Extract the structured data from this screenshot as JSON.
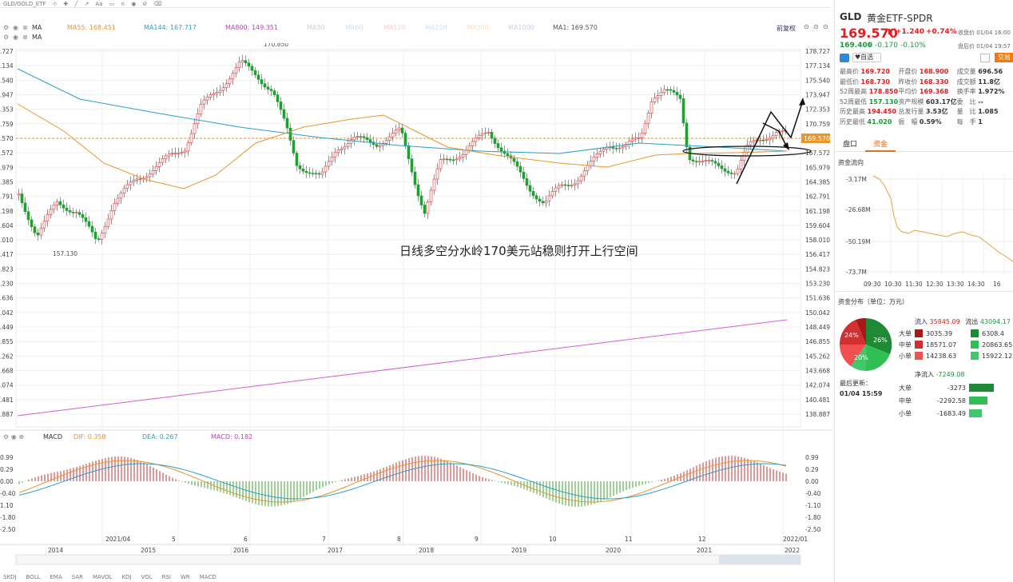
{
  "toolbar": {
    "ticker": "GLD/GOLD_ETF",
    "icons": [
      "cursor-icon",
      "crosshair-icon",
      "line-icon",
      "ray-icon",
      "text-icon",
      "ruler-icon",
      "magnet-icon",
      "eye-icon",
      "lock-icon",
      "trash-icon"
    ]
  },
  "ma_bar1": {
    "label": "MA",
    "ma55": "MA55: 168.451",
    "ma144": "MA144: 167.717",
    "ma800": "MA800: 149.351",
    "ma30": "MA30",
    "ma60": "MA60",
    "ma120": "MA120",
    "ma250": "MA250",
    "ma500": "MA500",
    "ma1000": "MA1000",
    "ma1": "MA1: 169.570",
    "fuquan": "前复权"
  },
  "ma_bar2": {
    "label": "MA"
  },
  "peak_label": "170.850",
  "low_label": "157.130",
  "annotation": "日线多空分水岭170美元站稳则打开上行空间",
  "price_axis": [
    "178.727",
    "177.134",
    "175.540",
    "173.947",
    "172.353",
    "170.759",
    "169.570",
    "167.572",
    "165.979",
    "164.385",
    "162.791",
    "161.198",
    "159.604",
    "158.010",
    "156.417",
    "154.823",
    "153.230",
    "151.636",
    "150.042",
    "148.449",
    "146.855",
    "145.262",
    "143.668",
    "142.074",
    "140.481",
    "138.887"
  ],
  "left_axis": [
    ".727",
    ".134",
    ".540",
    ".947",
    ".353",
    ".759",
    ".570",
    ".572",
    ".979",
    ".385",
    ".791",
    ".198",
    ".604",
    ".010",
    ".417",
    ".823",
    ".230",
    ".636",
    ".042",
    ".449",
    ".855",
    ".262",
    ".668",
    ".074",
    ".481",
    ".887"
  ],
  "current_price_tag": "169.570",
  "macd_bar": {
    "label": "MACD",
    "dif": "DIF: 0.358",
    "dea": "DEA: 0.267",
    "macd": "MACD: 0.182"
  },
  "macd_axis_right": [
    "0.99",
    "0.29",
    "0.00",
    "-0.40",
    "-1.10",
    "-1.80",
    "-2.50"
  ],
  "macd_axis_left": [
    "0.99",
    "0.29",
    "0.00",
    "-0.40",
    "1.10",
    "-1.80",
    "-2.50"
  ],
  "date_axis_upper": [
    "2021/04",
    "5",
    "6",
    "7",
    "8",
    "9",
    "10",
    "11",
    "12",
    "2022/01"
  ],
  "date_axis_lower": [
    "2014",
    "2015",
    "2016",
    "2017",
    "2018",
    "2019",
    "2020",
    "2021",
    "2022"
  ],
  "indicators": [
    "SKDJ",
    "BOLL",
    "EMA",
    "SAR",
    "MAVOL",
    "KDJ",
    "VOL",
    "RSI",
    "WR",
    "MACD"
  ],
  "side": {
    "code": "GLD",
    "name": "黄金ETF-SPDR",
    "price": "169.570",
    "change": "+1.240",
    "change_pct": "+0.74%",
    "close_time": "收盘价 01/04 16:00",
    "after_price": "169.400",
    "after_change": "-0.170",
    "after_pct": "-0.10%",
    "after_time": "盘后价 01/04 19:57",
    "add_watch": "自选",
    "trade_btn": "交易",
    "stats": [
      [
        [
          "最高价",
          "169.720"
        ],
        [
          "开盘价",
          "168.900"
        ],
        [
          "成交量",
          "696.56"
        ]
      ],
      [
        [
          "最低价",
          "168.730"
        ],
        [
          "昨收价",
          "168.330"
        ],
        [
          "成交额",
          "11.8亿"
        ]
      ],
      [
        [
          "52周最高",
          "178.850"
        ],
        [
          "平均价",
          "169.368"
        ],
        [
          "换手率",
          "1.972%"
        ]
      ],
      [
        [
          "52周最低",
          "157.130"
        ],
        [
          "资产规模",
          "603.17亿"
        ],
        [
          "委　比",
          "--"
        ]
      ],
      [
        [
          "历史最高",
          "194.450"
        ],
        [
          "总发行量",
          "3.53亿"
        ],
        [
          "量　比",
          "1.085"
        ]
      ],
      [
        [
          "历史最低",
          "41.020"
        ],
        [
          "振　幅",
          "0.59%"
        ],
        [
          "每　手",
          "1"
        ]
      ]
    ],
    "tab_pankou": "盘口",
    "tab_zijin": "资金",
    "flow_title": "资金流向",
    "flow_axis": [
      "-3.17M",
      "-26.68M",
      "-50.19M",
      "-73.7M"
    ],
    "flow_times": [
      "09:30",
      "10:30",
      "11:30",
      "12:30",
      "13:30",
      "14:30",
      "16"
    ],
    "dist_title": "资金分布（单位：万元）",
    "pie_labels": [
      "24%",
      "26%",
      "20%"
    ],
    "in_label": "流入",
    "in_total": "35845.09",
    "out_label": "流出",
    "out_total": "43094.17",
    "rows": [
      [
        "大单",
        "3035.39",
        "6308.4"
      ],
      [
        "中单",
        "18571.07",
        "20863.65"
      ],
      [
        "小单",
        "14238.63",
        "15922.12"
      ]
    ],
    "net_label": "净流入",
    "net_total": "-7249.08",
    "net_rows": [
      [
        "大单",
        "-3273"
      ],
      [
        "中单",
        "-2292.58"
      ],
      [
        "小单",
        "-1683.49"
      ]
    ],
    "update_label": "最后更新：",
    "update_time": "01/04 15:59"
  }
}
